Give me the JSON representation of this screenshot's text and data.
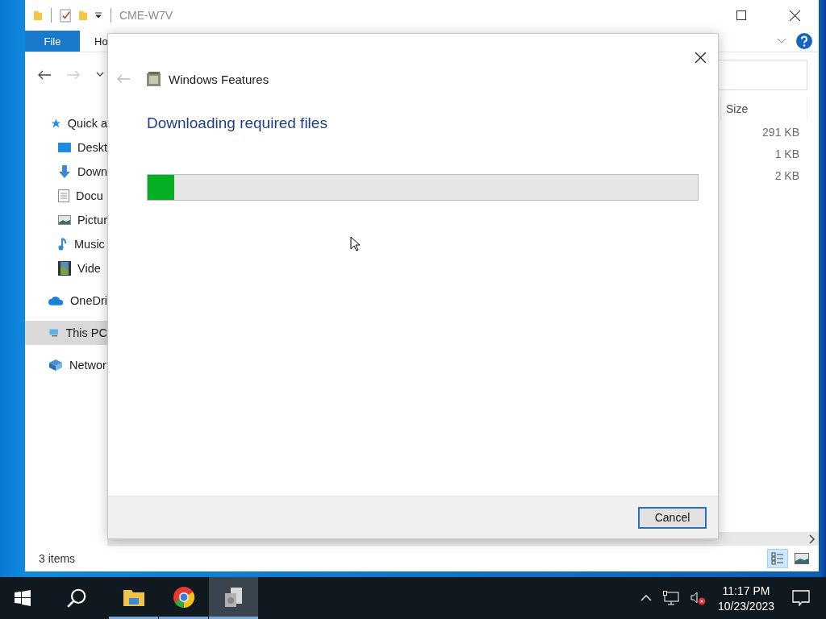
{
  "explorer": {
    "title": "CME-W7V",
    "file_menu": "File",
    "tabs": [
      {
        "label": "Ho",
        "selected": false
      }
    ],
    "nav_items": [
      {
        "label": "Quick a",
        "selected": false,
        "children": [
          {
            "label": "Deskt",
            "selected": false
          },
          {
            "label": "Down",
            "selected": false
          },
          {
            "label": "Docu",
            "selected": false
          },
          {
            "label": "Pictur",
            "selected": false
          },
          {
            "label": "Music",
            "selected": false
          },
          {
            "label": "Vide",
            "selected": false
          }
        ]
      },
      {
        "label": "OneDri",
        "selected": false
      },
      {
        "label": "This PC",
        "selected": true
      },
      {
        "label": "Networ",
        "selected": false
      }
    ],
    "column_header": "Size",
    "rows": [
      {
        "size": "291 KB"
      },
      {
        "size": "1 KB"
      },
      {
        "size": "2 KB"
      }
    ],
    "status": "3 items"
  },
  "dialog": {
    "title": "Windows Features",
    "heading": "Downloading required files",
    "progress": {
      "level": 0.048
    },
    "cancel": "Cancel"
  },
  "taskbar": {
    "apps": [
      {
        "active": false
      },
      {
        "active": false
      },
      {
        "active": true
      }
    ],
    "time": "11:17 PM",
    "date": "10/23/2023"
  }
}
